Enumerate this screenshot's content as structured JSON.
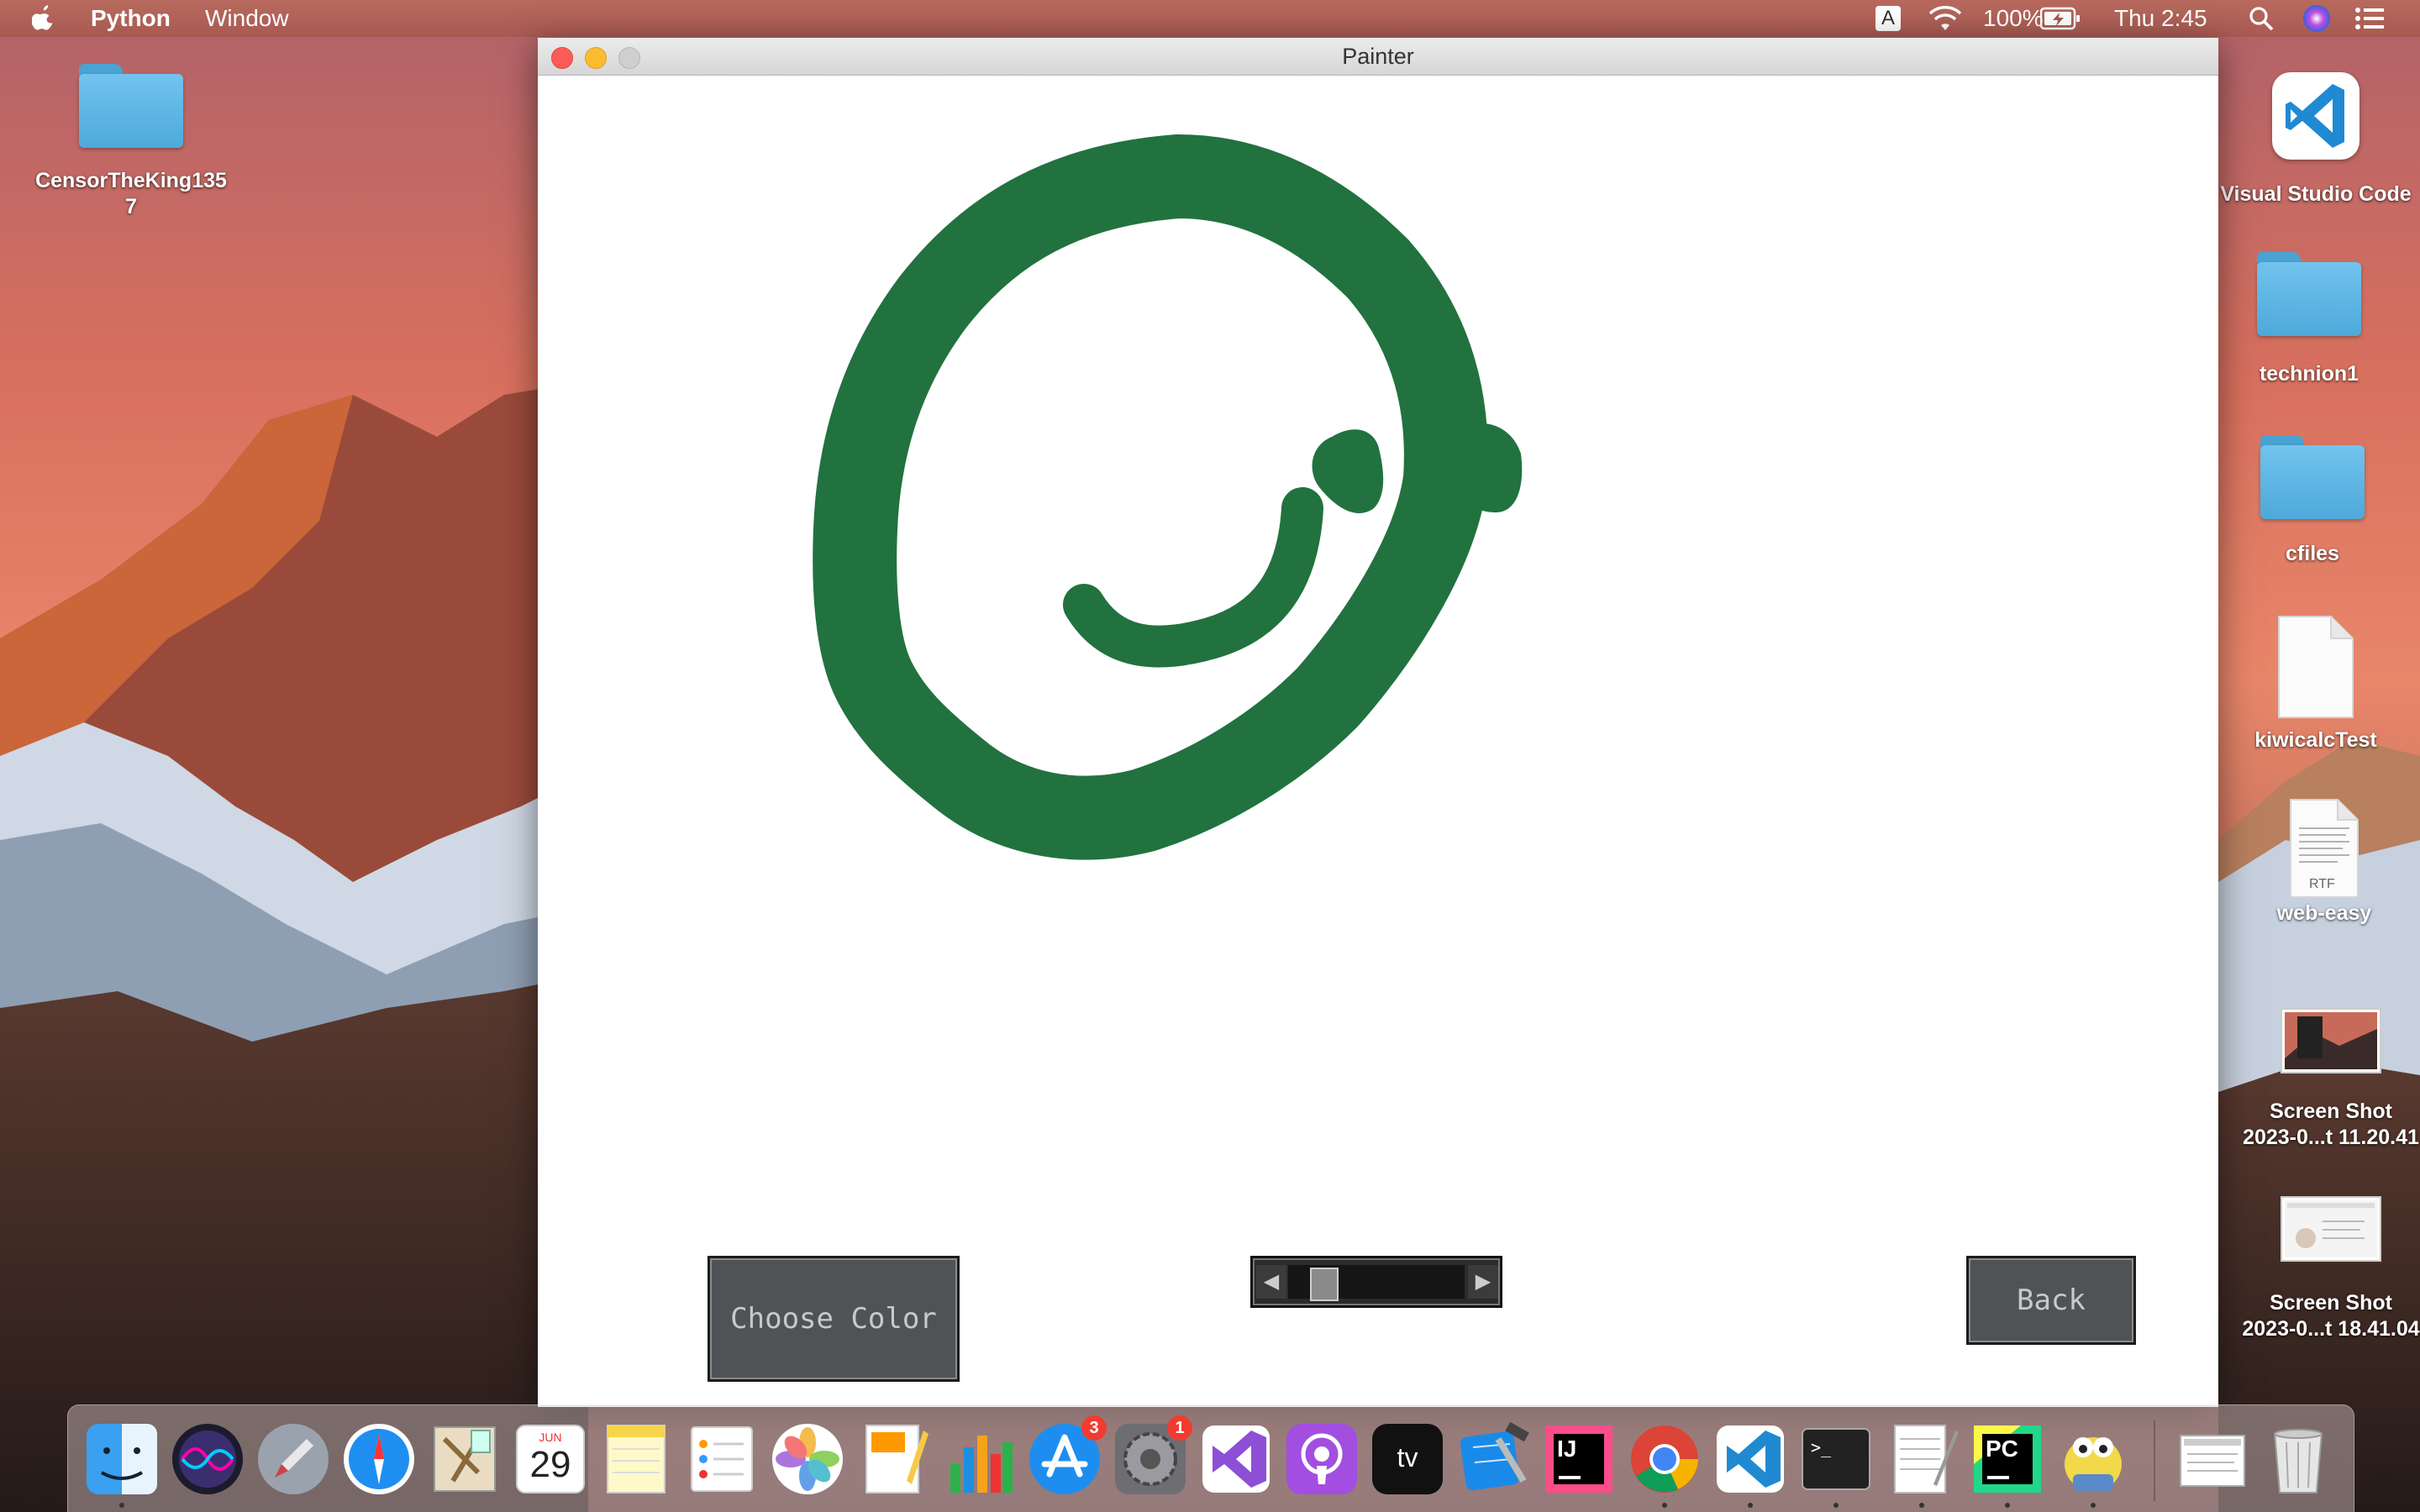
{
  "menubar": {
    "app_name": "Python",
    "menu_window": "Window",
    "input_indicator": "A",
    "battery_percent": "100%",
    "clock": "Thu 2:45"
  },
  "desktop": {
    "left_icons": [
      {
        "label": "CensorTheKing135\n7",
        "icon": "folder-icon"
      }
    ],
    "right_icons": [
      {
        "label": "Visual Studio Code",
        "icon": "vscode-app-icon"
      },
      {
        "label": "technion1",
        "icon": "folder-icon"
      },
      {
        "label": "cfiles",
        "icon": "folder-icon"
      },
      {
        "label": "kiwicalcTest",
        "icon": "document-icon"
      },
      {
        "label": "web-easy",
        "icon": "rtf-document-icon",
        "badge": "RTF"
      },
      {
        "label": "Screen Shot\n2023-0...t 11.20.41",
        "icon": "screenshot-thumbnail-icon"
      },
      {
        "label": "Screen Shot\n2023-0...t 18.41.04",
        "icon": "screenshot-thumbnail-icon"
      }
    ]
  },
  "window": {
    "title": "Painter",
    "drawing_color": "#21723f",
    "choose_color_label": "Choose Color",
    "back_label": "Back",
    "brush_size_fraction": 0.15
  },
  "dock": {
    "calendar_month": "JUN",
    "calendar_day": "29",
    "app_store_badge": "3",
    "settings_badge": "1",
    "appletv_label": "tv",
    "intellij_label": "IJ",
    "pycharm_label": "PC",
    "terminal_prompt": ">_",
    "apps": [
      "finder-icon",
      "siri-icon",
      "launchpad-icon",
      "safari-icon",
      "mail-icon",
      "calendar-icon",
      "notes-icon",
      "reminders-icon",
      "photos-icon",
      "pages-icon",
      "numbers-icon",
      "app-store-icon",
      "system-preferences-icon",
      "visual-studio-icon",
      "podcasts-icon",
      "apple-tv-icon",
      "xcode-icon",
      "intellij-icon",
      "chrome-icon",
      "vscode-icon",
      "terminal-icon",
      "textedit-icon",
      "pycharm-icon",
      "python-launcher-icon",
      "downloads-stack-icon",
      "trash-icon"
    ]
  },
  "colors": {
    "accent_green": "#21723f",
    "button_bg": "#505356",
    "menubar_bg": "#b06258"
  }
}
